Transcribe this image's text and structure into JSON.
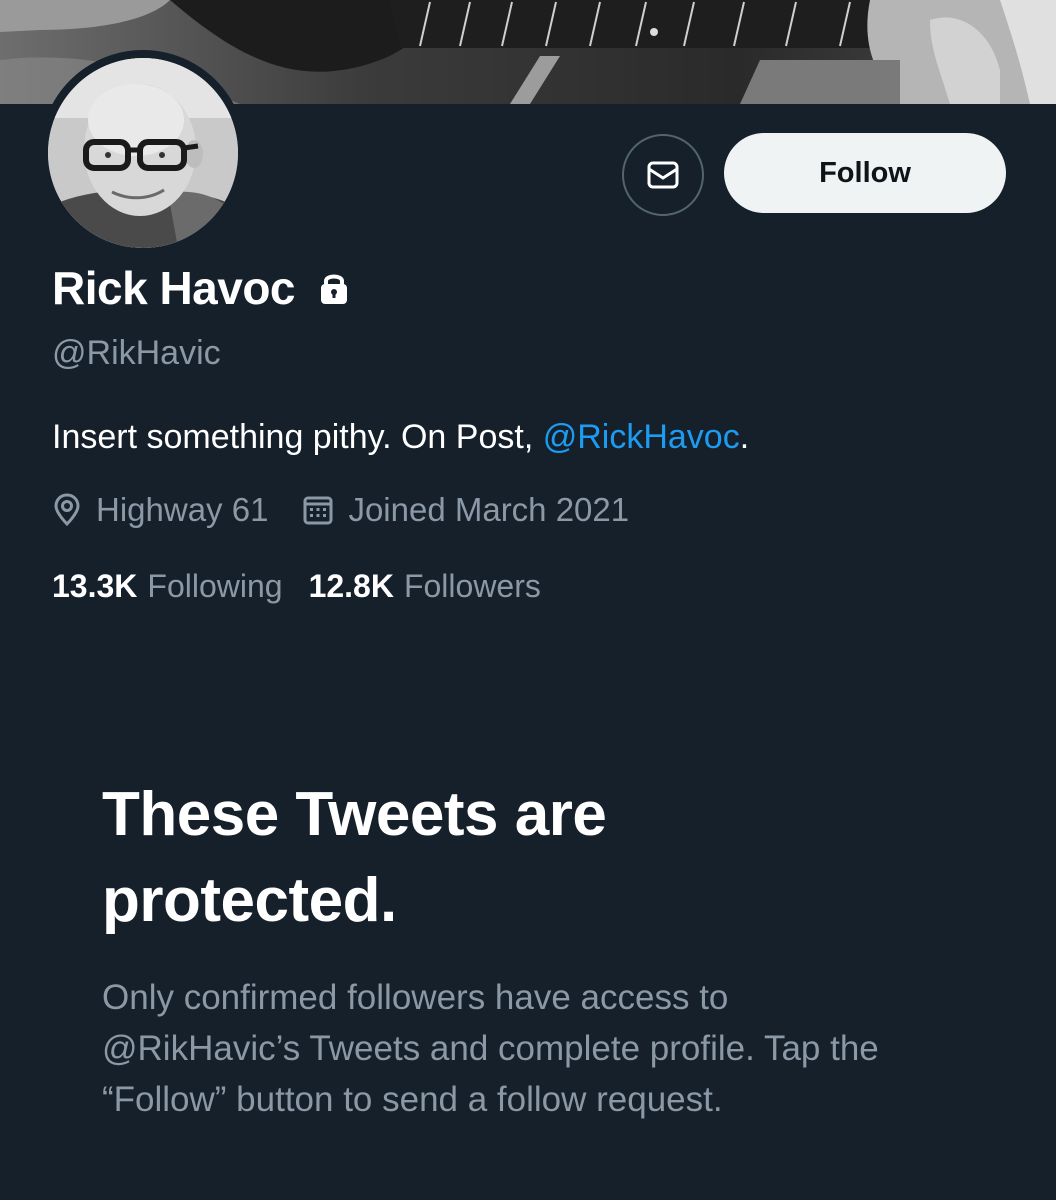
{
  "profile": {
    "display_name": "Rick Havoc",
    "handle": "@RikHavic",
    "bio_text": "Insert something pithy. On Post, ",
    "bio_mention": "@RickHavoc",
    "bio_suffix": ".",
    "location": "Highway 61",
    "joined": "Joined March 2021",
    "following_count": "13.3K",
    "following_label": "Following",
    "followers_count": "12.8K",
    "followers_label": "Followers"
  },
  "actions": {
    "follow_label": "Follow",
    "message_icon": "envelope-icon"
  },
  "icons": {
    "protected": "lock-icon",
    "location": "location-pin-icon",
    "joined": "calendar-icon"
  },
  "protected_notice": {
    "title": "These Tweets are protected.",
    "body": "Only confirmed followers have access to @RikHavic’s Tweets and complete profile. Tap the “Follow” button to send a follow request."
  },
  "colors": {
    "background": "#15202b",
    "primary_text": "#ffffff",
    "secondary_text": "#8b98a5",
    "link": "#1d9bf0",
    "follow_button_bg": "#eff3f4",
    "follow_button_text": "#0f1419"
  }
}
